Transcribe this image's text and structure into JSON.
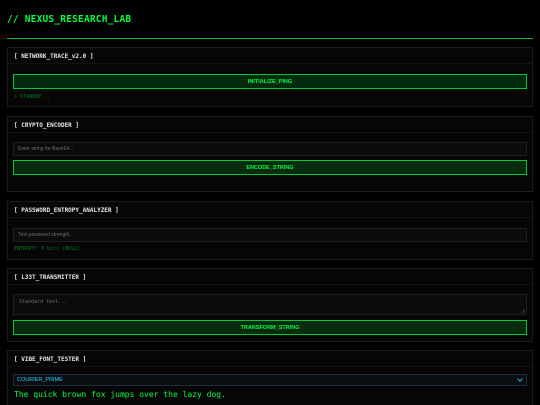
{
  "app": {
    "title": "// NEXUS_RESEARCH_LAB"
  },
  "network_trace": {
    "title": "[ NETWORK_TRACE_v2.0 ]",
    "button_label": "INITIALIZE_PING",
    "status": "> STANDBY..."
  },
  "crypto_encoder": {
    "title": "[ CRYPTO_ENCODER ]",
    "input_placeholder": "Enter string for Base64...",
    "button_label": "ENCODE_STRING"
  },
  "password_entropy": {
    "title": "[ PASSWORD_ENTROPY_ANALYZER ]",
    "input_placeholder": "Test password strength...",
    "status": "ENTROPY: 0 bits (NULL)"
  },
  "l33t_transmitter": {
    "title": "[ L33T_TRANSMITTER ]",
    "textarea_placeholder": "Standard text...",
    "button_label": "TRANSFORM_STRING"
  },
  "vibe_font_tester": {
    "title": "[ VIBE_FONT_TESTER ]",
    "selected_font": "COURIER_PRIME",
    "preview_text": "The quick brown fox jumps over the lazy dog."
  },
  "colors": {
    "accent": "#00ff41",
    "background": "#000000",
    "select_text": "#2fd0ff"
  }
}
